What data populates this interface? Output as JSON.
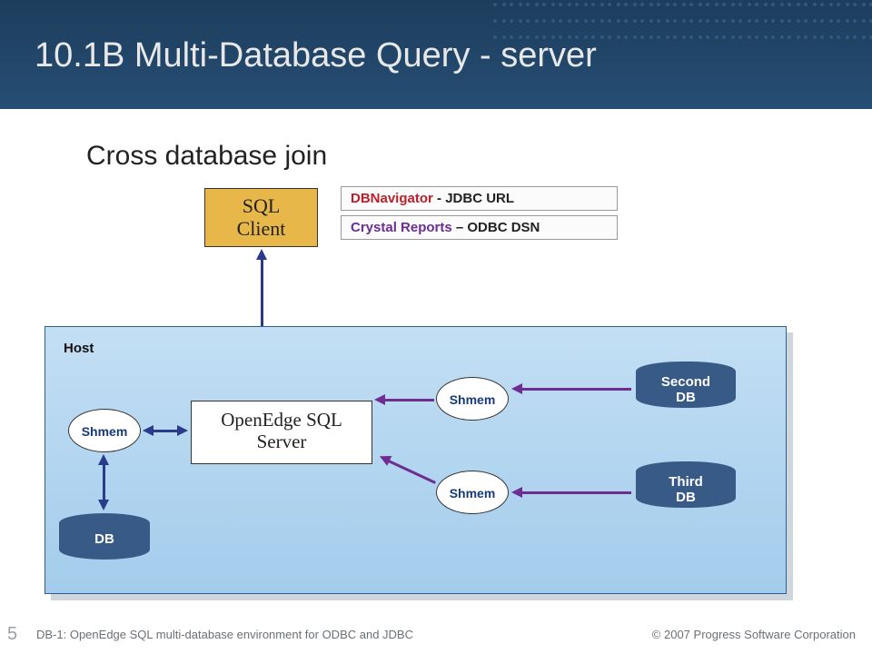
{
  "title": "10.1B Multi-Database Query - server",
  "subtitle": "Cross database join",
  "host_label": "Host",
  "nodes": {
    "sql_client": {
      "line1": "SQL",
      "line2": "Client"
    },
    "server": {
      "line1": "OpenEdge SQL",
      "line2": "Server"
    },
    "shmem_label": "Shmem",
    "dbs": [
      "DB",
      "Second\nDB",
      "Third\nDB"
    ]
  },
  "client_examples": [
    {
      "name": "DBNavigator",
      "via": "  - JDBC URL"
    },
    {
      "name": "Crystal Reports",
      "via": " – ODBC DSN"
    }
  ],
  "connections": [
    {
      "from": "sql_client",
      "to": "server",
      "dir": "both",
      "color": "navy"
    },
    {
      "from": "shmem_primary",
      "to": "server",
      "dir": "both",
      "color": "navy"
    },
    {
      "from": "shmem_primary",
      "to": "primary_db",
      "dir": "both",
      "color": "navy"
    },
    {
      "from": "shmem_second",
      "to": "server",
      "dir": "to",
      "color": "purple"
    },
    {
      "from": "shmem_third",
      "to": "server",
      "dir": "to",
      "color": "purple"
    },
    {
      "from": "second_db",
      "to": "shmem_second",
      "dir": "to",
      "color": "purple"
    },
    {
      "from": "third_db",
      "to": "shmem_third",
      "dir": "to",
      "color": "purple"
    }
  ],
  "footer": {
    "page": "5",
    "left": "DB-1: OpenEdge SQL multi-database environment for ODBC and JDBC",
    "right": "© 2007 Progress Software Corporation"
  },
  "colors": {
    "header": "#244c72",
    "host": "#b3d6ef",
    "sql_client": "#e7b74a",
    "db": "#385a86",
    "arrow_navy": "#2a3b8a",
    "arrow_purple": "#6e2d91"
  }
}
